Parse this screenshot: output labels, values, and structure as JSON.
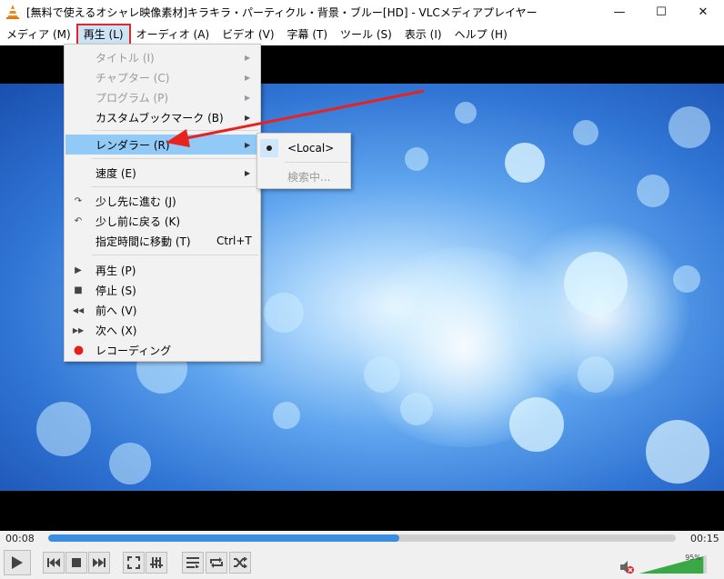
{
  "window": {
    "title": "[無料で使えるオシャレ映像素材]キラキラ・パーティクル・背景・ブルー[HD] - VLCメディアプレイヤー",
    "minimize": "—",
    "maximize": "☐",
    "close": "✕"
  },
  "menubar": {
    "items": [
      {
        "label": "メディア (M)"
      },
      {
        "label": "再生 (L)"
      },
      {
        "label": "オーディオ (A)"
      },
      {
        "label": "ビデオ (V)"
      },
      {
        "label": "字幕 (T)"
      },
      {
        "label": "ツール (S)"
      },
      {
        "label": "表示 (I)"
      },
      {
        "label": "ヘルプ (H)"
      }
    ]
  },
  "playback_menu": {
    "items": [
      {
        "label": "タイトル (I)",
        "disabled": true,
        "submenu": true
      },
      {
        "label": "チャプター (C)",
        "disabled": true,
        "submenu": true
      },
      {
        "label": "プログラム (P)",
        "disabled": true,
        "submenu": true
      },
      {
        "label": "カスタムブックマーク (B)",
        "submenu": true
      },
      {
        "label": "レンダラー (R)",
        "submenu": true,
        "highlighted": true
      },
      {
        "label": "速度 (E)",
        "submenu": true
      },
      {
        "label": "少し先に進む (J)",
        "icon": "jump-forward-icon"
      },
      {
        "label": "少し前に戻る (K)",
        "icon": "jump-backward-icon"
      },
      {
        "label": "指定時間に移動 (T)",
        "shortcut": "Ctrl+T"
      },
      {
        "label": "再生 (P)",
        "icon": "play-icon"
      },
      {
        "label": "停止 (S)",
        "icon": "stop-icon"
      },
      {
        "label": "前へ (V)",
        "icon": "previous-icon"
      },
      {
        "label": "次へ (X)",
        "icon": "next-icon"
      },
      {
        "label": "レコーディング",
        "icon": "record-icon"
      }
    ]
  },
  "renderer_submenu": {
    "items": [
      {
        "label": "<Local>",
        "checked": true
      },
      {
        "label": "検索中...",
        "disabled": true
      }
    ]
  },
  "controls": {
    "elapsed": "00:08",
    "total": "00:15",
    "progress": 0.56,
    "volume_label": "95%",
    "volume": 0.95
  },
  "colors": {
    "highlight": "#91c9f7",
    "active_outline": "#e3262b",
    "seek_fill": "#3c8ce0",
    "volume_fill": "#3aa845"
  }
}
